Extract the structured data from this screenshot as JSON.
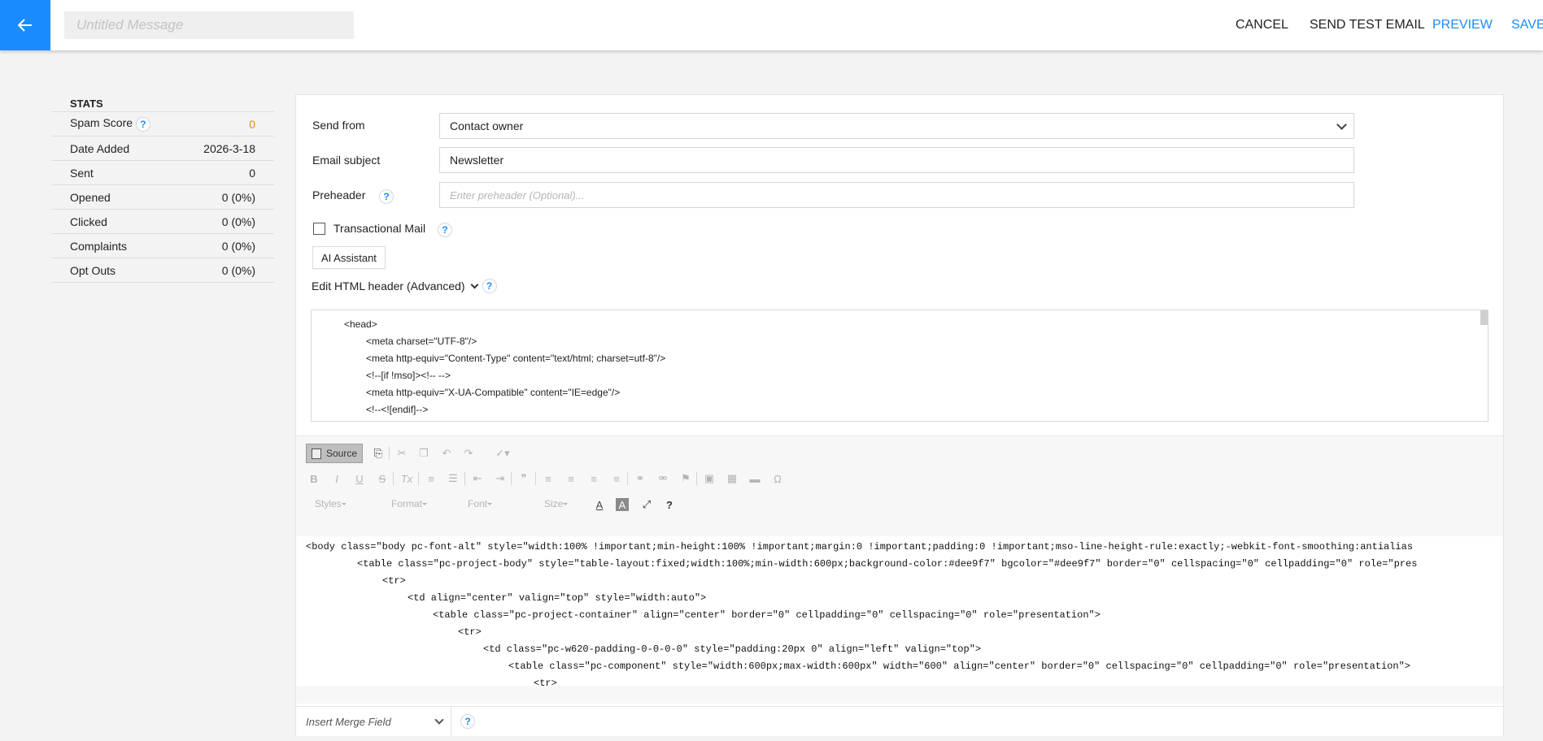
{
  "header": {
    "title_placeholder": "Untitled Message",
    "actions": {
      "cancel": "CANCEL",
      "send_test": "SEND TEST EMAIL",
      "preview": "PREVIEW",
      "save": "SAVE"
    }
  },
  "stats": {
    "title": "STATS",
    "rows": [
      {
        "label": "Spam Score",
        "value": "0",
        "help": "?"
      },
      {
        "label": "Date Added",
        "value": "2026-3-18"
      },
      {
        "label": "Sent",
        "value": "0"
      },
      {
        "label": "Opened",
        "value": "0 (0%)"
      },
      {
        "label": "Clicked",
        "value": "0 (0%)"
      },
      {
        "label": "Complaints",
        "value": "0 (0%)"
      },
      {
        "label": "Opt Outs",
        "value": "0 (0%)"
      }
    ]
  },
  "form": {
    "send_from_label": "Send from",
    "send_from_value": "Contact owner",
    "subject_label": "Email subject",
    "subject_value": "Newsletter",
    "preheader_label": "Preheader",
    "preheader_placeholder": "Enter preheader (Optional)...",
    "transactional_label": "Transactional Mail",
    "ai_button": "AI Assistant",
    "html_header_label": "Edit HTML header (Advanced)",
    "help": "?"
  },
  "html_header": [
    "<head>",
    "<meta charset=\"UTF-8\"/>",
    "<meta http-equiv=\"Content-Type\" content=\"text/html; charset=utf-8\"/>",
    "<!--[if !mso]><!-- -->",
    "<meta http-equiv=\"X-UA-Compatible\" content=\"IE=edge\"/>",
    "<!--<![endif]-->"
  ],
  "editor": {
    "source_label": "Source",
    "styles": "Styles",
    "format": "Format",
    "font": "Font",
    "size": "Size",
    "code": [
      "<body class=\"body pc-font-alt\" style=\"width:100% !important;min-height:100% !important;margin:0 !important;padding:0 !important;mso-line-height-rule:exactly;-webkit-font-smoothing:antialias",
      "<table class=\"pc-project-body\" style=\"table-layout:fixed;width:100%;min-width:600px;background-color:#dee9f7\" bgcolor=\"#dee9f7\" border=\"0\" cellspacing=\"0\" cellpadding=\"0\" role=\"pres",
      "<tr>",
      "<td align=\"center\" valign=\"top\" style=\"width:auto\">",
      "<table class=\"pc-project-container\" align=\"center\" border=\"0\" cellpadding=\"0\" cellspacing=\"0\" role=\"presentation\">",
      "<tr>",
      "<td class=\"pc-w620-padding-0-0-0-0\" style=\"padding:20px 0\" align=\"left\" valign=\"top\">",
      "<table class=\"pc-component\" style=\"width:600px;max-width:600px\" width=\"600\" align=\"center\" border=\"0\" cellspacing=\"0\" cellpadding=\"0\" role=\"presentation\">",
      "<tr>"
    ],
    "merge_field": "Insert Merge Field"
  },
  "colors": {
    "accent": "#1a8cff",
    "spam_score": "#e38d13"
  }
}
